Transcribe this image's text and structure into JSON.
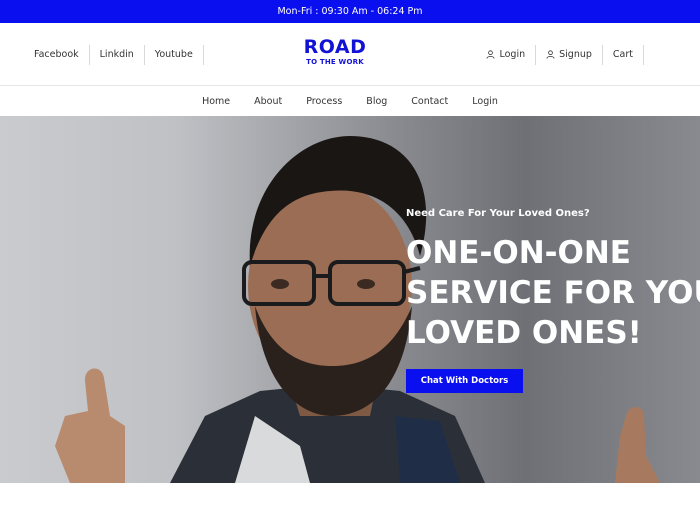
{
  "topbar": {
    "hours": "Mon-Fri : 09:30 Am - 06:24 Pm"
  },
  "header": {
    "social": [
      "Facebook",
      "Linkdin",
      "Youtube"
    ],
    "logo": {
      "line1": "ROAD",
      "line2": "TO THE WORK"
    },
    "account": {
      "login": "Login",
      "signup": "Signup",
      "cart": "Cart"
    }
  },
  "nav": [
    "Home",
    "About",
    "Process",
    "Blog",
    "Contact",
    "Login"
  ],
  "hero": {
    "subtitle": "Need Care For Your Loved Ones?",
    "title_lines": [
      "ONE-ON-ONE",
      "SERVICE FOR YOUR",
      "LOVED ONES!"
    ],
    "cta": "Chat With Doctors"
  },
  "colors": {
    "brand": "#0a0ff0",
    "logo": "#1212d6"
  },
  "icons": [
    "user-icon"
  ]
}
